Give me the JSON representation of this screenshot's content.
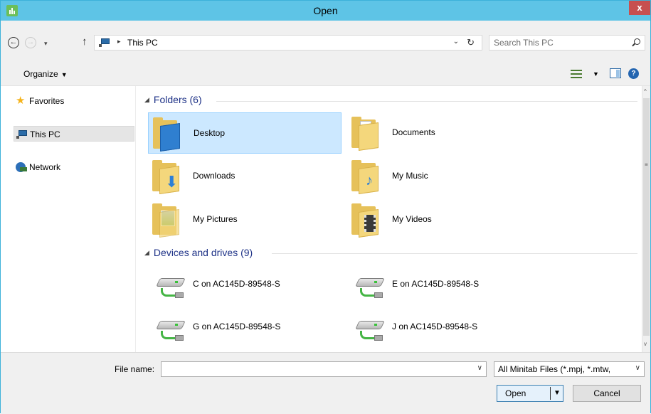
{
  "window": {
    "title": "Open",
    "close_glyph": "x"
  },
  "address": {
    "back_glyph": "←",
    "forward_glyph": "→",
    "history_glyph": "▾",
    "up_glyph": "↑",
    "separator": "▸",
    "path": "This PC",
    "dropdown_glyph": "⌄",
    "refresh_glyph": "↻"
  },
  "search": {
    "placeholder": "Search This PC"
  },
  "toolbar": {
    "organize_label": "Organize",
    "organize_arrow": "▼",
    "view_arrow": "▼",
    "help_glyph": "?"
  },
  "navigation": {
    "items": [
      {
        "label": "Favorites",
        "icon": "star-icon"
      },
      {
        "label": "This PC",
        "icon": "computer-icon",
        "selected": true
      },
      {
        "label": "Network",
        "icon": "network-icon"
      }
    ]
  },
  "content": {
    "groups": [
      {
        "title": "Folders (6)",
        "collapse_glyph": "◢",
        "items": [
          {
            "label": "Desktop",
            "icon": "desktop-folder-icon",
            "selected": true
          },
          {
            "label": "Documents",
            "icon": "documents-folder-icon"
          },
          {
            "label": "Downloads",
            "icon": "downloads-folder-icon"
          },
          {
            "label": "My Music",
            "icon": "music-folder-icon"
          },
          {
            "label": "My Pictures",
            "icon": "pictures-folder-icon"
          },
          {
            "label": "My Videos",
            "icon": "videos-folder-icon"
          }
        ]
      },
      {
        "title": "Devices and drives (9)",
        "collapse_glyph": "◢",
        "items": [
          {
            "label": "C on AC145D-89548-S",
            "icon": "network-drive-icon"
          },
          {
            "label": "E on AC145D-89548-S",
            "icon": "network-drive-icon"
          },
          {
            "label": "G on AC145D-89548-S",
            "icon": "network-drive-icon"
          },
          {
            "label": "J on AC145D-89548-S",
            "icon": "network-drive-icon"
          }
        ]
      }
    ]
  },
  "scrollbar": {
    "up_glyph": "^",
    "down_glyph": "v",
    "grip_glyph": "≡"
  },
  "footer": {
    "file_name_label": "File name:",
    "file_name_value": "",
    "file_name_dropdown": "∨",
    "file_type_selected": "All Minitab Files (*.mpj, *.mtw,",
    "file_type_dropdown": "∨",
    "open_label": "Open",
    "open_arrow": "▼",
    "cancel_label": "Cancel"
  },
  "colors": {
    "titlebar": "#5ec4e6",
    "close_button": "#c75050",
    "selection": "#cce8ff",
    "group_header": "#1e3287",
    "folder": "#f4d77c"
  }
}
